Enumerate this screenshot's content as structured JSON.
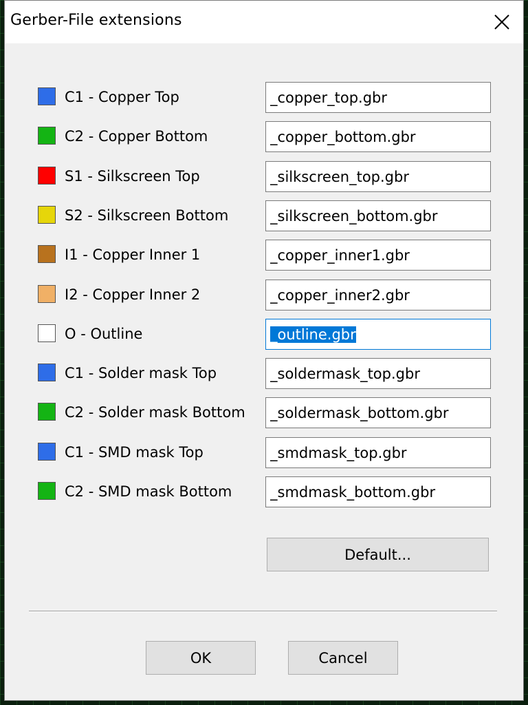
{
  "window": {
    "title": "Gerber-File extensions"
  },
  "layers": [
    {
      "label": "C1 - Copper Top",
      "color": "#2e6de8",
      "value": "_copper_top.gbr"
    },
    {
      "label": "C2 - Copper Bottom",
      "color": "#14b414",
      "value": "_copper_bottom.gbr"
    },
    {
      "label": "S1 - Silkscreen Top",
      "color": "#ff0000",
      "value": "_silkscreen_top.gbr"
    },
    {
      "label": "S2 - Silkscreen Bottom",
      "color": "#e6d60a",
      "value": "_silkscreen_bottom.gbr"
    },
    {
      "label": "I1 - Copper Inner 1",
      "color": "#b8721e",
      "value": "_copper_inner1.gbr"
    },
    {
      "label": "I2 - Copper Inner 2",
      "color": "#f0b066",
      "value": "_copper_inner2.gbr"
    },
    {
      "label": "O - Outline",
      "color": "#ffffff",
      "value": "_outline.gbr"
    },
    {
      "label": "C1 - Solder mask Top",
      "color": "#2e6de8",
      "value": "_soldermask_top.gbr"
    },
    {
      "label": "C2 - Solder mask Bottom",
      "color": "#14b414",
      "value": "_soldermask_bottom.gbr"
    },
    {
      "label": "C1 - SMD mask Top",
      "color": "#2e6de8",
      "value": "_smdmask_top.gbr"
    },
    {
      "label": "C2 - SMD mask Bottom",
      "color": "#14b414",
      "value": "_smdmask_bottom.gbr"
    }
  ],
  "buttons": {
    "default_label": "Default...",
    "ok_label": "OK",
    "cancel_label": "Cancel"
  },
  "focus": {
    "active_field": "_outline.gbr"
  }
}
